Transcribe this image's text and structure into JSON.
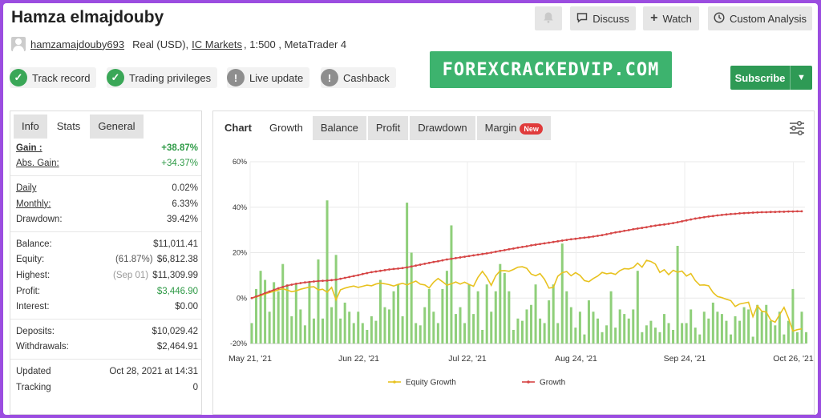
{
  "header": {
    "title": "Hamza elmajdouby",
    "discuss": "Discuss",
    "watch": "Watch",
    "custom_analysis": "Custom Analysis",
    "username": "hamzamajdouby693",
    "account_type": "Real (USD),",
    "broker": "IC Markets",
    "account_tail": ", 1:500 , MetaTrader 4"
  },
  "badges": [
    {
      "label": "Track record",
      "icon": "check-icon"
    },
    {
      "label": "Trading privileges",
      "icon": "check-icon"
    },
    {
      "label": "Live update",
      "icon": "exclamation-icon"
    },
    {
      "label": "Cashback",
      "icon": "exclamation-icon"
    }
  ],
  "promo": "FOREXCRACKEDVIP.COM",
  "subscribe": "Subscribe",
  "left_tabs": [
    "Info",
    "Stats",
    "General"
  ],
  "stats": {
    "gain": {
      "label": "Gain :",
      "value": "+38.87%"
    },
    "abs_gain": {
      "label": "Abs. Gain:",
      "value": "+34.37%"
    },
    "daily": {
      "label": "Daily",
      "value": "0.02%"
    },
    "monthly": {
      "label": "Monthly:",
      "value": "6.33%"
    },
    "drawdown": {
      "label": "Drawdown:",
      "value": "39.42%"
    },
    "balance": {
      "label": "Balance:",
      "value": "$11,011.41"
    },
    "equity": {
      "label": "Equity:",
      "note": "(61.87%)",
      "value": "$6,812.38"
    },
    "highest": {
      "label": "Highest:",
      "note": "(Sep 01)",
      "value": "$11,309.99"
    },
    "profit": {
      "label": "Profit:",
      "value": "$3,446.90"
    },
    "interest": {
      "label": "Interest:",
      "value": "$0.00"
    },
    "deposits": {
      "label": "Deposits:",
      "value": "$10,029.42"
    },
    "withdrawals": {
      "label": "Withdrawals:",
      "value": "$2,464.91"
    },
    "updated": {
      "label": "Updated",
      "value": "Oct 28, 2021 at 14:31"
    },
    "tracking": {
      "label": "Tracking",
      "value": "0"
    }
  },
  "chart_tabs": {
    "chart": "Chart",
    "growth": "Growth",
    "balance": "Balance",
    "profit": "Profit",
    "drawdown": "Drawdown",
    "margin": "Margin",
    "new_badge": "New"
  },
  "colors": {
    "accent_green": "#3db36e",
    "subscribe": "#2e9a55",
    "growth_line": "#d64545",
    "equity_line": "#e8c21f",
    "bars": "#8fcf7a",
    "frame": "#9b4de0"
  },
  "chart_data": {
    "type": "bar",
    "y_tick_labels": [
      "60%",
      "40%",
      "20%",
      "0%",
      "-20%"
    ],
    "ylim": [
      -20,
      60
    ],
    "x_tick_labels": [
      "May 21, '21",
      "Jun 22, '21",
      "Jul 22, '21",
      "Aug 24, '21",
      "Sep 24, '21",
      "Oct 26, '21"
    ],
    "legend": [
      "Equity Growth",
      "Growth"
    ],
    "grid": true,
    "series": [
      {
        "name": "Growth",
        "type": "line",
        "values": [
          0.0,
          0.7,
          1.4,
          2.2,
          2.9,
          3.6,
          4.3,
          4.9,
          5.5,
          5.9,
          6.3,
          6.6,
          6.9,
          7.1,
          7.3,
          7.5,
          7.6,
          7.7,
          7.9,
          8.1,
          8.5,
          8.9,
          9.3,
          9.7,
          10.1,
          10.6,
          11.0,
          11.4,
          11.7,
          12.0,
          12.3,
          12.6,
          12.8,
          13.0,
          13.2,
          13.5,
          13.9,
          14.3,
          14.7,
          15.1,
          15.5,
          15.9,
          16.2,
          16.6,
          17.0,
          17.3,
          17.6,
          17.9,
          18.2,
          18.5,
          18.8,
          19.1,
          19.4,
          19.7,
          20.0,
          20.4,
          20.8,
          21.1,
          21.5,
          21.8,
          22.2,
          22.5,
          22.8,
          23.2,
          23.5,
          23.8,
          24.1,
          24.4,
          24.7,
          25.0,
          25.3,
          25.6,
          25.9,
          26.1,
          26.4,
          26.6,
          26.8,
          27.1,
          27.4,
          27.7,
          28.1,
          28.5,
          28.9,
          29.2,
          29.6,
          29.9,
          30.3,
          30.6,
          30.9,
          31.2,
          31.6,
          31.9,
          32.2,
          32.4,
          32.7,
          33.0,
          33.4,
          33.8,
          34.2,
          34.6,
          35.0,
          35.3,
          35.6,
          35.9,
          36.1,
          36.4,
          36.6,
          36.8,
          37.0,
          37.1,
          37.3,
          37.4,
          37.5,
          37.6,
          37.7,
          37.8,
          37.8,
          37.9,
          37.9,
          38.0,
          38.0,
          38.1,
          38.1,
          38.2,
          38.2
        ]
      },
      {
        "name": "Equity Growth",
        "type": "line",
        "values": [
          0.0,
          0.5,
          1.1,
          1.8,
          2.4,
          3.0,
          3.6,
          4.1,
          3.5,
          2.8,
          3.2,
          3.9,
          4.4,
          4.8,
          5.0,
          3.6,
          3.9,
          2.6,
          4.7,
          -0.8,
          3.6,
          4.4,
          4.9,
          5.3,
          4.7,
          5.2,
          5.7,
          5.4,
          6.2,
          6.6,
          6.3,
          5.9,
          5.3,
          6.0,
          6.5,
          5.8,
          6.7,
          7.5,
          6.1,
          5.8,
          4.5,
          7.0,
          8.6,
          7.2,
          5.7,
          6.3,
          7.1,
          6.2,
          7.0,
          6.0,
          5.2,
          9.1,
          11.8,
          9.1,
          5.6,
          9.8,
          12.0,
          12.1,
          11.8,
          12.6,
          13.6,
          13.8,
          13.1,
          10.6,
          9.8,
          10.8,
          8.3,
          4.4,
          4.7,
          9.6,
          11.2,
          11.7,
          9.8,
          11.2,
          10.0,
          7.7,
          7.2,
          8.6,
          9.7,
          11.3,
          10.7,
          11.0,
          10.4,
          12.1,
          13.0,
          12.8,
          13.4,
          15.4,
          13.6,
          16.6,
          16.1,
          15.0,
          11.3,
          12.5,
          10.3,
          12.2,
          11.4,
          11.9,
          9.7,
          10.8,
          7.7,
          5.7,
          5.8,
          5.4,
          2.4,
          0.7,
          0.2,
          -0.5,
          -1.1,
          -3.7,
          -2.6,
          -2.2,
          -1.8,
          -8.2,
          -3.4,
          -5.8,
          -6.1,
          -9.7,
          -10.6,
          -7.3,
          -4.1,
          -8.8,
          -14.5,
          -13.9,
          -13.5
        ]
      },
      {
        "name": "Daily",
        "type": "bar",
        "values": [
          -11.0,
          4.0,
          12.0,
          8.0,
          -6.0,
          7.0,
          3.0,
          15.0,
          6.0,
          -8.0,
          6.0,
          -5.0,
          -12.0,
          7.0,
          -9.0,
          17.0,
          -9.0,
          43.0,
          -4.0,
          19.0,
          -9.0,
          -2.0,
          -6.0,
          -11.0,
          -6.0,
          -11.0,
          -14.0,
          -8.0,
          -10.0,
          8.0,
          -4.0,
          -5.0,
          3.0,
          6.0,
          -8.0,
          42.0,
          20.0,
          -11.0,
          -12.0,
          -4.0,
          4.0,
          -6.0,
          -11.0,
          4.0,
          12.0,
          32.0,
          -7.0,
          -4.0,
          -11.0,
          6.0,
          -7.0,
          3.0,
          -14.0,
          6.0,
          -6.0,
          3.0,
          15.0,
          11.0,
          3.0,
          -14.0,
          -9.0,
          -10.0,
          -5.0,
          -3.0,
          6.0,
          -9.0,
          -11.0,
          -1.0,
          6.0,
          -11.0,
          24.0,
          3.0,
          -4.0,
          -13.0,
          -6.0,
          -16.0,
          -1.0,
          -6.0,
          -9.0,
          -15.0,
          -12.0,
          3.0,
          -13.0,
          -5.0,
          -7.0,
          -9.0,
          -5.0,
          12.0,
          -15.0,
          -12.0,
          -10.0,
          -13.0,
          -15.0,
          -7.0,
          -11.0,
          -14.0,
          23.0,
          -11.0,
          -11.0,
          -5.0,
          -13.0,
          -16.0,
          -6.0,
          -9.0,
          -2.0,
          -6.0,
          -7.0,
          -10.0,
          -16.0,
          -8.0,
          -10.0,
          -4.0,
          -5.0,
          -17.0,
          -3.0,
          -6.0,
          -3.0,
          -10.0,
          -12.0,
          -6.0,
          -16.0,
          -10.0,
          4.0,
          -15.0,
          -6.0,
          -15.0
        ]
      }
    ]
  }
}
